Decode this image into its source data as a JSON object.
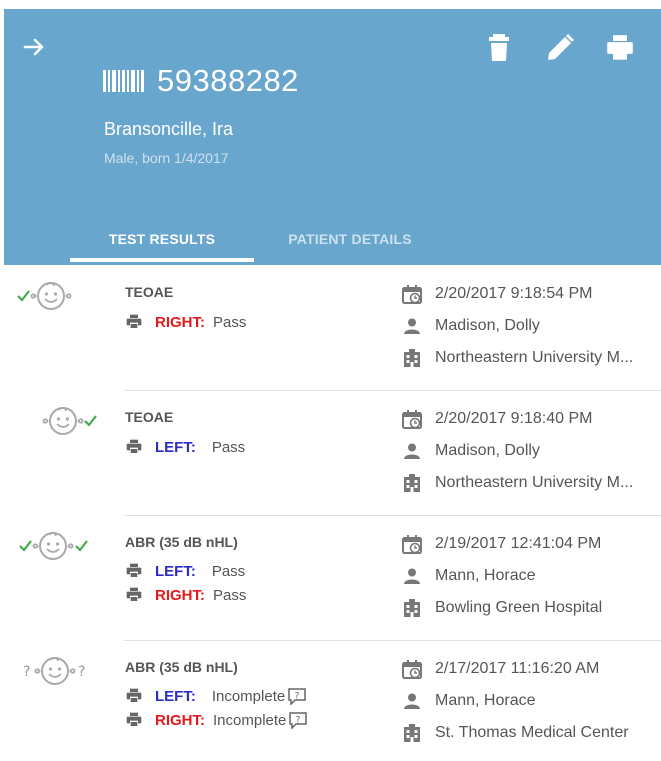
{
  "header": {
    "patient_id": "59388282",
    "patient_name": "Bransoncille, Ira",
    "patient_meta": "Male, born 1/4/2017",
    "bg_color": "#69a6cd",
    "icons": [
      "arrow-right-icon",
      "trash-icon",
      "pencil-icon",
      "printer-icon",
      "barcode-icon"
    ]
  },
  "tabs": [
    {
      "label": "TEST RESULTS",
      "active": true
    },
    {
      "label": "PATIENT DETAILS",
      "active": false
    }
  ],
  "colors": {
    "left": "#2c2cc6",
    "right": "#e31b1b",
    "pass_check": "#3aa845"
  },
  "results": [
    {
      "test": "TEOAE",
      "ears": [
        {
          "side": "RIGHT:",
          "outcome": "Pass",
          "note": false
        }
      ],
      "date": "2/20/2017 9:18:54 PM",
      "screener": "Madison, Dolly",
      "location": "Northeastern University M..."
    },
    {
      "test": "TEOAE",
      "ears": [
        {
          "side": "LEFT:",
          "outcome": "Pass",
          "note": false
        }
      ],
      "date": "2/20/2017 9:18:40 PM",
      "screener": "Madison, Dolly",
      "location": "Northeastern University M..."
    },
    {
      "test": "ABR (35 dB nHL)",
      "ears": [
        {
          "side": "LEFT:",
          "outcome": "Pass",
          "note": false
        },
        {
          "side": "RIGHT:",
          "outcome": "Pass",
          "note": false
        }
      ],
      "date": "2/19/2017 12:41:04 PM",
      "screener": "Mann, Horace",
      "location": "Bowling Green Hospital"
    },
    {
      "test": "ABR (35 dB nHL)",
      "ears": [
        {
          "side": "LEFT:",
          "outcome": "Incomplete",
          "note": true
        },
        {
          "side": "RIGHT:",
          "outcome": "Incomplete",
          "note": true
        }
      ],
      "date": "2/17/2017 11:16:20 AM",
      "screener": "Mann, Horace",
      "location": "St. Thomas Medical Center"
    }
  ]
}
